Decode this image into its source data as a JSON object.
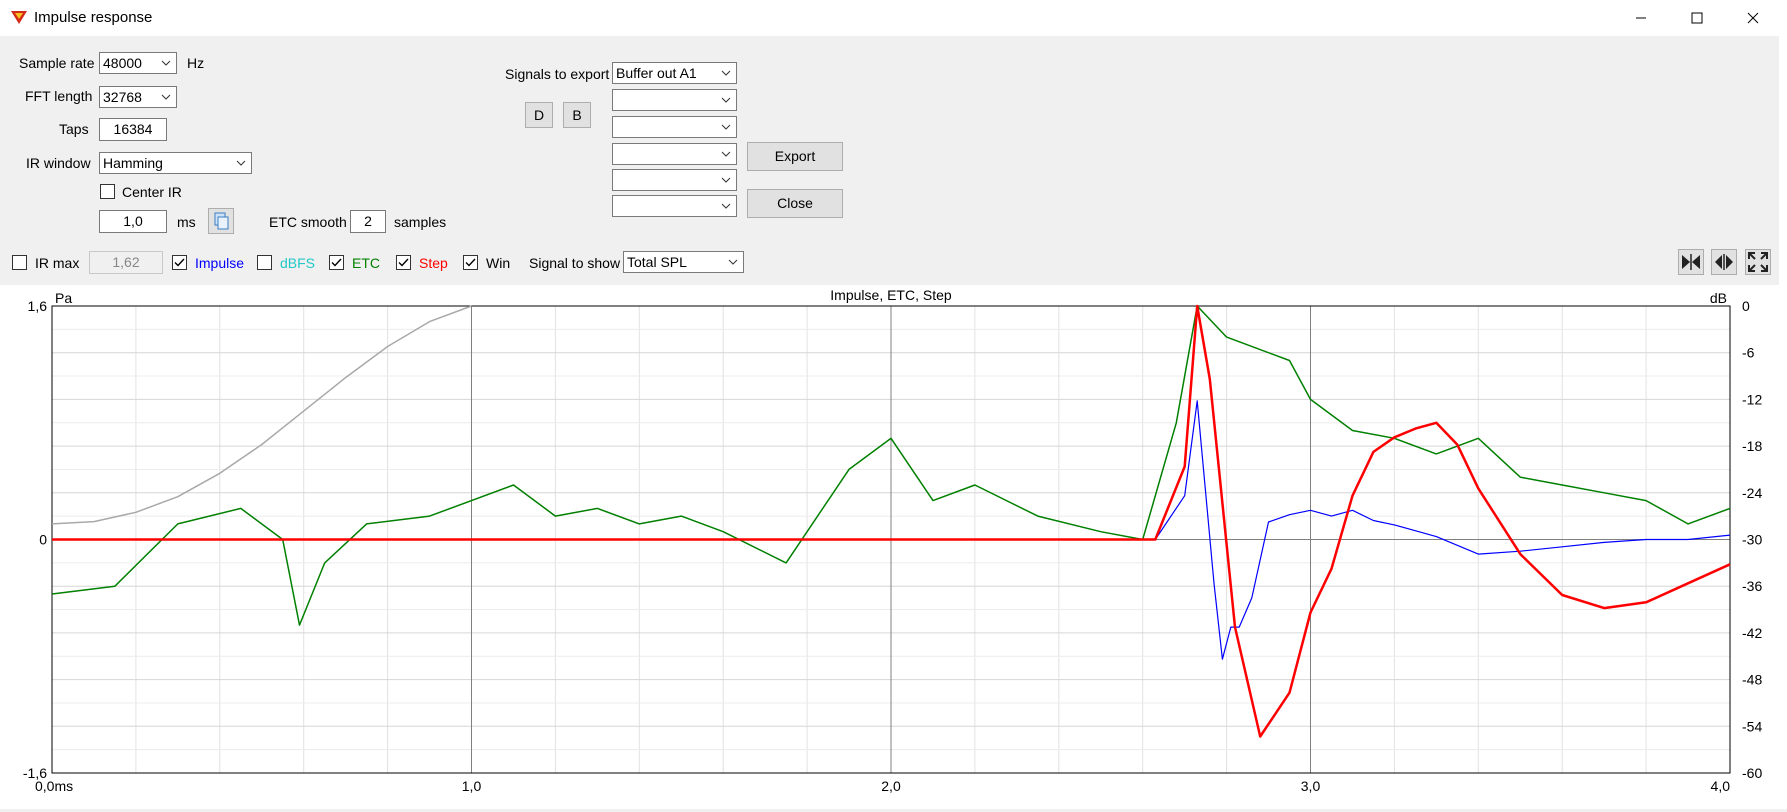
{
  "window": {
    "title": "Impulse response",
    "minimize_glyph": "—",
    "maximize_glyph": "☐",
    "close_glyph": "✕"
  },
  "controls": {
    "sample_rate": {
      "label": "Sample rate",
      "value": "48000",
      "unit": "Hz"
    },
    "fft_length": {
      "label": "FFT length",
      "value": "32768"
    },
    "taps": {
      "label": "Taps",
      "value": "16384"
    },
    "ir_window": {
      "label": "IR window",
      "value": "Hamming"
    },
    "center_ir": {
      "label": "Center IR",
      "checked": false
    },
    "window_time": {
      "value": "1,0",
      "unit": "ms"
    },
    "etc_smooth": {
      "label": "ETC smooth",
      "value": "2",
      "unit": "samples"
    }
  },
  "export": {
    "label": "Signals to export",
    "signals": [
      "Buffer out A1",
      "",
      "",
      "",
      "",
      ""
    ],
    "d_button": "D",
    "b_button": "B",
    "export_button": "Export",
    "close_button": "Close"
  },
  "display": {
    "ir_max": {
      "label": "IR max",
      "checked": false,
      "value": "1,62"
    },
    "impulse": {
      "label": "Impulse",
      "checked": true,
      "color": "#0000ff"
    },
    "dbfs": {
      "label": "dBFS",
      "checked": false,
      "color": "#22c7c7"
    },
    "etc": {
      "label": "ETC",
      "checked": true,
      "color": "#008000"
    },
    "step": {
      "label": "Step",
      "checked": true,
      "color": "#ff0000"
    },
    "win": {
      "label": "Win",
      "checked": true
    },
    "signal_to_show": {
      "label": "Signal to show",
      "value": "Total SPL"
    }
  },
  "chart_data": {
    "type": "line",
    "title": "Impulse, ETC, Step",
    "ylabel_left": "Pa",
    "ylabel_right": "dB",
    "xlim": [
      0,
      4.0
    ],
    "ylim_left": [
      -1.6,
      1.6
    ],
    "ylim_right": [
      -60,
      0
    ],
    "x_tick_labels": [
      "0,0ms",
      "1,0",
      "2,0",
      "3,0",
      "4,0"
    ],
    "y_left_tick_labels": [
      "1,6",
      "0",
      "-1,6"
    ],
    "y_right_tick_labels": [
      "0",
      "-6",
      "-12",
      "-18",
      "-24",
      "-30",
      "-36",
      "-42",
      "-48",
      "-54",
      "-60"
    ],
    "grid": true,
    "series": [
      {
        "name": "Impulse",
        "axis": "left",
        "color": "#0000ff",
        "x": [
          0,
          2.63,
          2.7,
          2.73,
          2.77,
          2.79,
          2.81,
          2.83,
          2.86,
          2.9,
          2.95,
          3.0,
          3.05,
          3.1,
          3.15,
          3.2,
          3.3,
          3.4,
          3.5,
          3.6,
          3.7,
          3.8,
          3.9,
          4.0
        ],
        "y": [
          0,
          0,
          0.3,
          0.95,
          -0.3,
          -0.82,
          -0.6,
          -0.6,
          -0.4,
          0.12,
          0.17,
          0.2,
          0.16,
          0.2,
          0.13,
          0.1,
          0.02,
          -0.1,
          -0.08,
          -0.05,
          -0.02,
          0.0,
          0.0,
          0.03
        ]
      },
      {
        "name": "Step",
        "axis": "left",
        "color": "#ff0000",
        "x": [
          0,
          2.63,
          2.7,
          2.73,
          2.76,
          2.82,
          2.88,
          2.95,
          3.0,
          3.05,
          3.1,
          3.15,
          3.2,
          3.25,
          3.3,
          3.35,
          3.4,
          3.5,
          3.6,
          3.7,
          3.8,
          3.9,
          4.0
        ],
        "y": [
          0,
          0,
          0.5,
          1.6,
          1.1,
          -0.6,
          -1.35,
          -1.05,
          -0.5,
          -0.2,
          0.3,
          0.6,
          0.7,
          0.76,
          0.8,
          0.65,
          0.35,
          -0.1,
          -0.38,
          -0.47,
          -0.43,
          -0.3,
          -0.17
        ]
      },
      {
        "name": "ETC",
        "axis": "right",
        "color": "#008000",
        "x": [
          0,
          0.15,
          0.3,
          0.45,
          0.55,
          0.59,
          0.65,
          0.75,
          0.9,
          1.1,
          1.2,
          1.3,
          1.4,
          1.5,
          1.6,
          1.75,
          1.9,
          2.0,
          2.1,
          2.2,
          2.35,
          2.5,
          2.6,
          2.68,
          2.73,
          2.8,
          2.95,
          3.0,
          3.1,
          3.2,
          3.3,
          3.4,
          3.5,
          3.6,
          3.7,
          3.8,
          3.9,
          4.0
        ],
        "y": [
          -37,
          -36,
          -28,
          -26,
          -30,
          -41,
          -33,
          -28,
          -27,
          -23,
          -27,
          -26,
          -28,
          -27,
          -29,
          -33,
          -21,
          -17,
          -25,
          -23,
          -27,
          -29,
          -30,
          -15,
          0,
          -4,
          -7,
          -12,
          -16,
          -17,
          -19,
          -17,
          -22,
          -23,
          -24,
          -25,
          -28,
          -26
        ]
      },
      {
        "name": "Window",
        "axis": "right",
        "color": "#a9a9a9",
        "x": [
          0,
          0.1,
          0.2,
          0.3,
          0.4,
          0.5,
          0.6,
          0.7,
          0.8,
          0.9,
          1.0
        ],
        "y": [
          -28,
          -27.7,
          -26.5,
          -24.5,
          -21.5,
          -17.8,
          -13.5,
          -9.2,
          -5.2,
          -2.0,
          0
        ]
      }
    ]
  }
}
